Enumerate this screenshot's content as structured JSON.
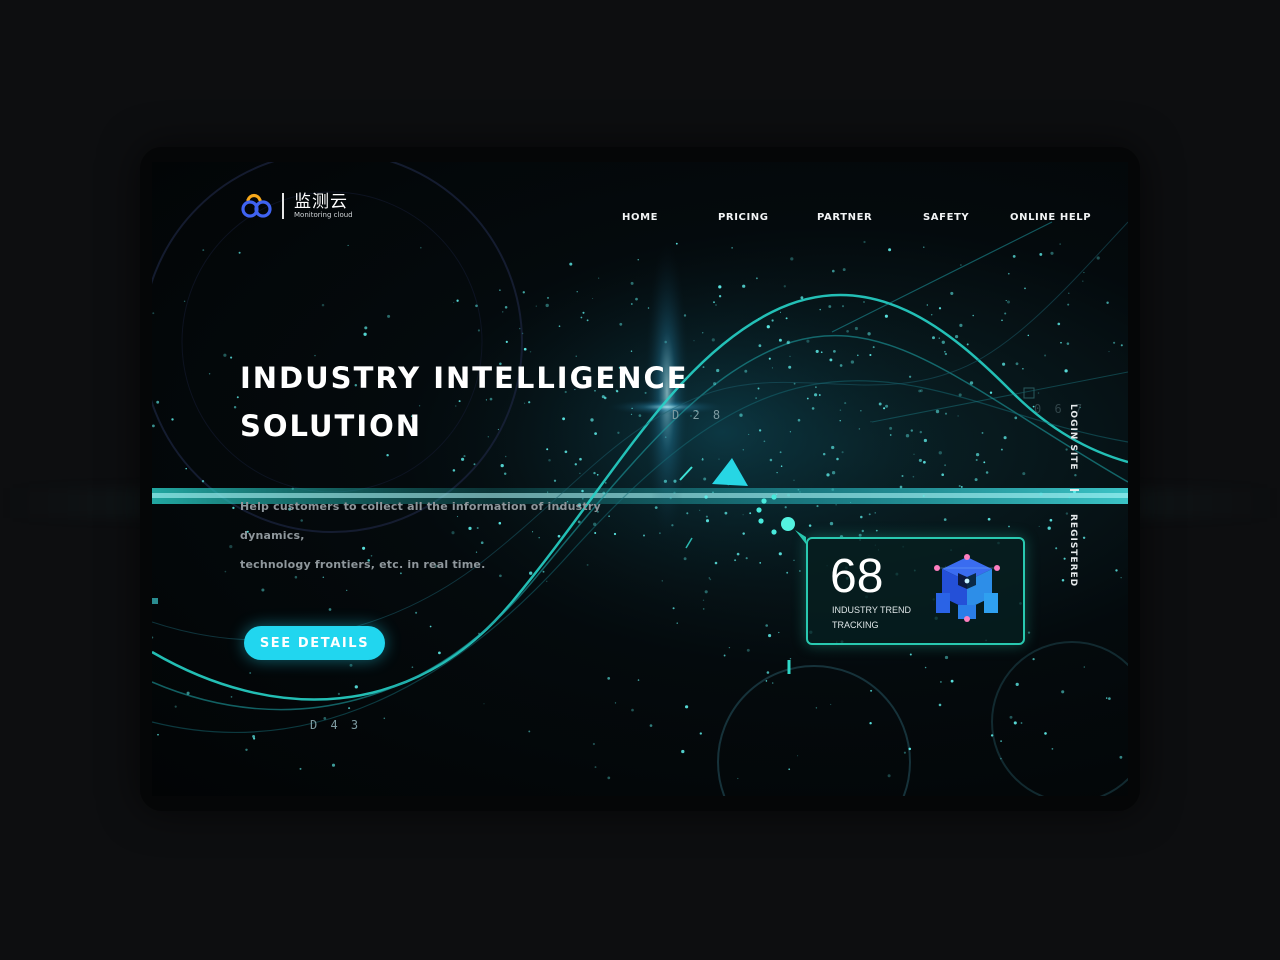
{
  "brand": {
    "name_cn": "监测云",
    "name_en": "Monitoring cloud",
    "colors": {
      "logo_blue": "#3f63f2",
      "logo_orange": "#f7a81b"
    }
  },
  "nav": {
    "items": [
      {
        "label": "HOME"
      },
      {
        "label": "PRICING"
      },
      {
        "label": "PARTNER"
      },
      {
        "label": "SAFETY"
      },
      {
        "label": "ONLINE HELP"
      }
    ]
  },
  "hero": {
    "title_line1": "INDUSTRY INTELLIGENCE",
    "title_line2": "SOLUTION",
    "desc_line1": "Help customers to collect all the information of industry dynamics,",
    "desc_line2": "technology frontiers, etc. in real time.",
    "cta_label": "SEE DETAILS"
  },
  "stat_card": {
    "value": "68",
    "label_line1": "INDUSTRY TREND",
    "label_line2": "TRACKING",
    "icon": "cube-network-icon"
  },
  "side_links": {
    "login": "LOGIN SITE",
    "register": "REGISTERED"
  },
  "hud_labels": {
    "top": "D 2 8",
    "bottom": "D 4 3",
    "right": "0 6 7"
  },
  "colors": {
    "accent": "#21d6ef",
    "card_border": "#29c9b0",
    "background": "#0d0e10"
  }
}
